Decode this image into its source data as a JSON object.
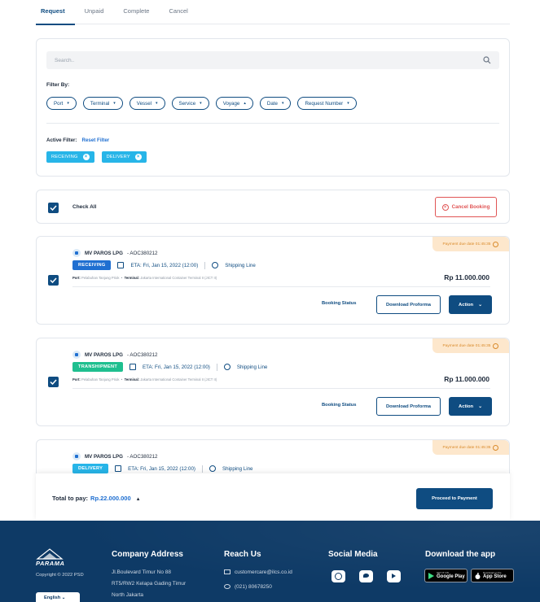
{
  "tabs": [
    {
      "label": "Request",
      "active": true
    },
    {
      "label": "Unpaid",
      "active": false
    },
    {
      "label": "Complete",
      "active": false
    },
    {
      "label": "Cancel",
      "active": false
    }
  ],
  "filter": {
    "search_placeholder": "Search..",
    "filter_by_label": "Filter By:",
    "chips": [
      {
        "label": "Port",
        "caret": "▾"
      },
      {
        "label": "Terminal",
        "caret": "▾"
      },
      {
        "label": "Vessel",
        "caret": "▾"
      },
      {
        "label": "Service",
        "caret": "▾"
      },
      {
        "label": "Voyage",
        "caret": "▴"
      },
      {
        "label": "Date",
        "caret": "▾"
      },
      {
        "label": "Request Number",
        "caret": "▾"
      }
    ],
    "active_filter_label": "Active Filter:",
    "reset_label": "Reset Filter",
    "active_tags": [
      "RECEIVING",
      "DELIVERY"
    ]
  },
  "check_all": {
    "label": "Check All",
    "checked": true,
    "cancel_label": "Cancel Booking"
  },
  "bookings": [
    {
      "due": "Payment due date 01:45:35",
      "vessel": "MV PAROS LPG",
      "code": "- AOC380212",
      "status": "RECEIVING",
      "status_color": "#1f6fd1",
      "eta": "ETA: Fri, Jan 15, 2022 (12:00)",
      "line": "Shipping Line",
      "port_label": "Port:",
      "port": "Pelabuhan Tanjung Priok",
      "terminal_label": "Terminal:",
      "terminal": "Jakarta International Container Terminal II (JICT II)",
      "price": "Rp 11.000.000",
      "booking_status_label": "Booking Status",
      "proforma_label": "Download Proforma",
      "action_label": "Action",
      "checked": true
    },
    {
      "due": "Payment due date 01:45:35",
      "vessel": "MV PAROS LPG",
      "code": "- AOC380212",
      "status": "TRANSHIPMENT",
      "status_color": "#1fbf8f",
      "eta": "ETA: Fri, Jan 15, 2022 (12:00)",
      "line": "Shipping Line",
      "port_label": "Port:",
      "port": "Pelabuhan Tanjung Priok",
      "terminal_label": "Terminal:",
      "terminal": "Jakarta International Container Terminal II (JICT II)",
      "price": "Rp 11.000.000",
      "booking_status_label": "Booking Status",
      "proforma_label": "Download Proforma",
      "action_label": "Action",
      "checked": true
    },
    {
      "due": "Payment due date 01:45:35",
      "vessel": "MV PAROS LPG",
      "code": "- AOC380212",
      "status": "DELIVERY",
      "status_color": "#27b5e8",
      "eta": "ETA: Fri, Jan 15, 2022 (12:00)",
      "line": "Shipping Line"
    }
  ],
  "total": {
    "label": "Total to pay:",
    "amount": "Rp.22.000.000",
    "pay_label": "Proceed to Payment"
  },
  "footer": {
    "logo_text": "PARAMA",
    "copyright": "Copyright © 2022 PSD",
    "language": "English",
    "company_title": "Company Address",
    "address_lines": [
      "Jl.Boulevard Timur No 88",
      "RT5/RW2 Kelapa Gading Timur",
      "North Jakarta"
    ],
    "reach_title": "Reach Us",
    "email": "customercare@ilcs.co.id",
    "phone": "(021) 80678250",
    "social_title": "Social Media",
    "app_title": "Download the app",
    "google_small": "GET IT ON",
    "google_label": "Google Play",
    "apple_small": "Download on the",
    "apple_label": "App Store"
  },
  "colors": {
    "primary": "#0f4c81",
    "accent_blue": "#1f6fd1",
    "cyan": "#27b5e8",
    "green": "#1fbf8f",
    "danger": "#e05555",
    "due_bg": "#fde7cc",
    "footer_bg": "#0e3a66"
  }
}
